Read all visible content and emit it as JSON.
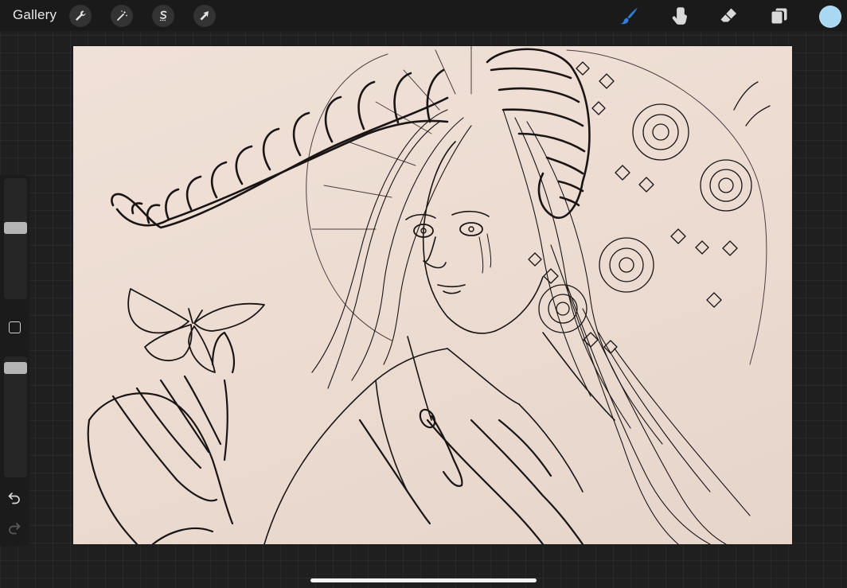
{
  "toolbar": {
    "gallery_label": "Gallery",
    "left_tools": [
      {
        "name": "actions",
        "icon": "wrench-icon"
      },
      {
        "name": "adjustments",
        "icon": "magic-wand-icon"
      },
      {
        "name": "selection",
        "icon": "selection-s-icon"
      },
      {
        "name": "transform",
        "icon": "arrow-cursor-icon"
      }
    ],
    "right_tools": [
      {
        "name": "brush",
        "icon": "brush-icon",
        "active": true
      },
      {
        "name": "smudge",
        "icon": "smudge-finger-icon",
        "active": false
      },
      {
        "name": "eraser",
        "icon": "eraser-icon",
        "active": false
      },
      {
        "name": "layers",
        "icon": "layers-icon",
        "active": false
      }
    ],
    "current_color": "#a9d8f2"
  },
  "sidebar": {
    "brush_size": 0.6,
    "opacity": 0.95
  },
  "colors": {
    "active_tool": "#2f7fd6",
    "toolbar_bg": "#1a1a1a",
    "canvas_paper": "#ecdcd2",
    "ink": "#1a1515"
  }
}
